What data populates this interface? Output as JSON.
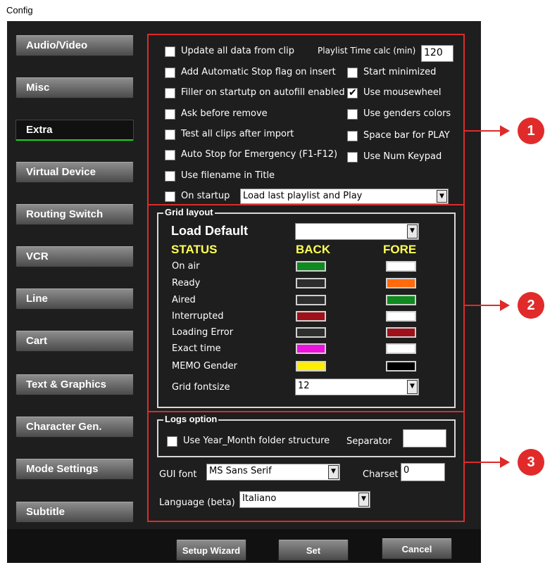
{
  "window": {
    "title": "Config"
  },
  "nav": [
    "Audio/Video",
    "Misc",
    "Extra",
    "Virtual Device",
    "Routing Switch",
    "VCR",
    "Line",
    "Cart",
    "Text & Graphics",
    "Character Gen.",
    "Mode Settings",
    "Subtitle"
  ],
  "extra": {
    "update_all": "Update all data from clip",
    "playlist_time_label": "Playlist Time calc (min)",
    "playlist_time_value": "120",
    "add_auto_stop": "Add Automatic Stop flag on insert",
    "start_minimized": "Start minimized",
    "filler": "Filler on startutp on autofill enabled",
    "use_mousewheel": "Use mousewheel",
    "ask_remove": "Ask before remove",
    "use_genders": "Use genders colors",
    "test_clips": "Test all clips after import",
    "space_bar": "Space bar for PLAY",
    "auto_stop_emergency": "Auto Stop for Emergency (F1-F12)",
    "use_num_keypad": "Use Num Keypad",
    "use_filename": "Use filename in Title",
    "on_startup": "On startup",
    "on_startup_value": "Load last playlist and Play"
  },
  "grid": {
    "title": "Grid layout",
    "load_default": "Load Default",
    "load_default_value": "",
    "status_header": "STATUS",
    "back_header": "BACK",
    "fore_header": "FORE",
    "rows": [
      {
        "label": "On air",
        "back": "#0f8a1f",
        "fore": "#ffffff"
      },
      {
        "label": "Ready",
        "back": "#2e2e2e",
        "fore": "#ff6a0d"
      },
      {
        "label": "Aired",
        "back": "#2e2e2e",
        "fore": "#0f8a1f"
      },
      {
        "label": "Interrupted",
        "back": "#a0101a",
        "fore": "#ffffff"
      },
      {
        "label": "Loading Error",
        "back": "#2e2e2e",
        "fore": "#a0101a"
      },
      {
        "label": "Exact time",
        "back": "#ee11dd",
        "fore": "#ffffff"
      },
      {
        "label": "MEMO Gender",
        "back": "#ffee00",
        "fore": "#000000"
      }
    ],
    "fontsize_label": "Grid fontsize",
    "fontsize_value": "12"
  },
  "logs": {
    "title": "Logs option",
    "year_month": "Use Year_Month folder structure",
    "separator_label": "Separator",
    "separator_value": "",
    "gui_font_label": "GUI font",
    "gui_font_value": "MS Sans Serif",
    "charset_label": "Charset",
    "charset_value": "0",
    "language_label": "Language (beta)",
    "language_value": "Italiano"
  },
  "buttons": {
    "setup_wizard": "Setup Wizard",
    "set": "Set",
    "cancel": "Cancel"
  },
  "markers": [
    "1",
    "2",
    "3"
  ],
  "colors": {
    "highlight_red": "#dd2a2a",
    "active_underline": "#1fd41f",
    "header_yellow": "#ffff55"
  }
}
